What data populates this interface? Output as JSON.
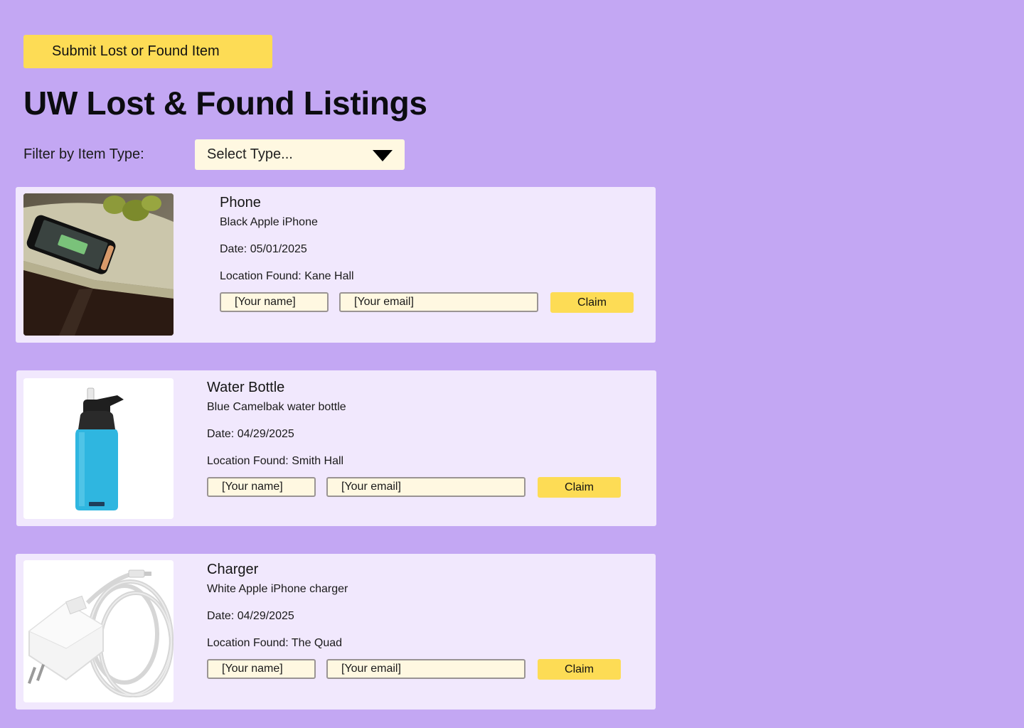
{
  "header": {
    "submit_label": "Submit Lost or Found Item",
    "title": "UW Lost & Found Listings"
  },
  "filter": {
    "label": "Filter by Item Type:",
    "selected": "Select Type..."
  },
  "listings": [
    {
      "image": "phone-photo",
      "title": "Phone",
      "description": "Black Apple iPhone",
      "date": "Date: 05/01/2025",
      "location": "Location Found: Kane Hall",
      "name_placeholder": "[Your name]",
      "email_placeholder": "[Your email]",
      "claim_label": "Claim"
    },
    {
      "image": "water-bottle-photo",
      "title": "Water Bottle",
      "description": "Blue Camelbak water bottle",
      "date": "Date: 04/29/2025",
      "location": "Location Found: Smith Hall",
      "name_placeholder": "[Your name]",
      "email_placeholder": "[Your email]",
      "claim_label": "Claim"
    },
    {
      "image": "charger-photo",
      "title": "Charger",
      "description": "White Apple iPhone charger",
      "date": "Date: 04/29/2025",
      "location": "Location Found: The Quad",
      "name_placeholder": "[Your name]",
      "email_placeholder": "[Your email]",
      "claim_label": "Claim"
    }
  ],
  "colors": {
    "background": "#c3a7f3",
    "card": "#f1e8fd",
    "accent_button": "#fddc55",
    "input_fill": "#fff8e1"
  }
}
